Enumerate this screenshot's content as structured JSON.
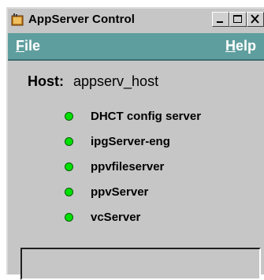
{
  "window": {
    "title": "AppServer Control"
  },
  "title_buttons": {
    "minimize": "_",
    "maximize": "□",
    "close": "×"
  },
  "menu": {
    "file": {
      "accel": "F",
      "rest": "ile"
    },
    "help": {
      "accel": "H",
      "rest": "elp"
    }
  },
  "host": {
    "label": "Host:",
    "value": "appserv_host"
  },
  "servers": [
    {
      "name": "DHCT config server",
      "status": "running"
    },
    {
      "name": "ipgServer-eng",
      "status": "running"
    },
    {
      "name": "ppvfileserver",
      "status": "running"
    },
    {
      "name": "ppvServer",
      "status": "running"
    },
    {
      "name": "vcServer",
      "status": "running"
    }
  ],
  "status_bar": {
    "text": ""
  },
  "colors": {
    "menubar": "#5f9e9e",
    "window_bg": "#c6c6c6",
    "status_running": "#00e000"
  }
}
